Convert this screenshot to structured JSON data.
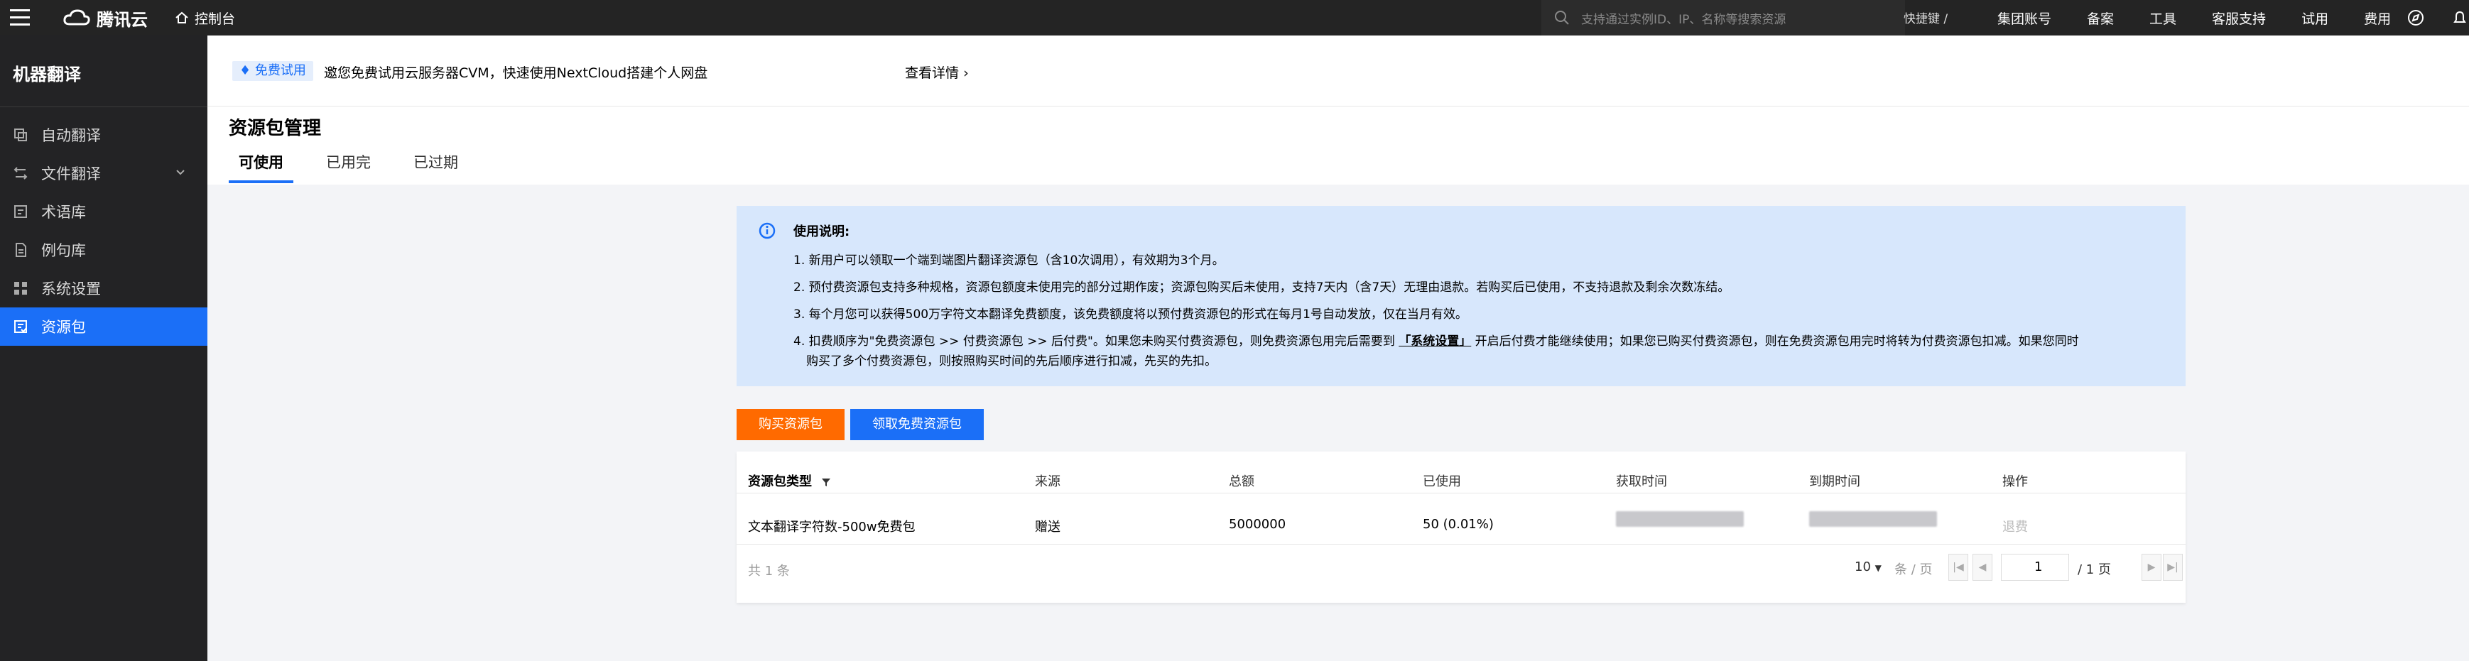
{
  "topbar": {
    "brand": "腾讯云",
    "console": "控制台",
    "search_placeholder": "支持通过实例ID、IP、名称等搜索资源",
    "shortcut": "快捷键 /",
    "links": [
      "集团账号",
      "备案",
      "工具",
      "客服支持",
      "试用",
      "费用"
    ]
  },
  "sidebar": {
    "title": "机器翻译",
    "items": [
      {
        "label": "自动翻译",
        "icon": "translate-icon"
      },
      {
        "label": "文件翻译",
        "icon": "file-icon"
      },
      {
        "label": "术语库",
        "icon": "glossary-icon"
      },
      {
        "label": "例句库",
        "icon": "sentence-icon"
      },
      {
        "label": "系统设置",
        "icon": "settings-grid-icon"
      },
      {
        "label": "资源包",
        "icon": "package-icon"
      }
    ]
  },
  "notice": {
    "badge": "免费试用",
    "text": "邀您免费试用云服务器CVM，快速使用NextCloud搭建个人网盘",
    "more": "查看详情"
  },
  "page": {
    "title": "资源包管理",
    "tabs": [
      "可使用",
      "已用完",
      "已过期"
    ]
  },
  "info": {
    "heading": "使用说明:",
    "line1": "1. 新用户可以领取一个端到端图片翻译资源包（含10次调用），有效期为3个月。",
    "line2": "2. 预付费资源包支持多种规格，资源包额度未使用完的部分过期作废；资源包购买后未使用，支持7天内（含7天）无理由退款。若购买后已使用，不支持退款及剩余次数冻结。",
    "line3": "3. 每个月您可以获得500万字符文本翻译免费额度，该免费额度将以预付费资源包的形式在每月1号自动发放，仅在当月有效。",
    "line4a": "4. 扣费顺序为\"免费资源包 >> 付费资源包 >> 后付费\"。如果您未购买付费资源包，则免费资源包用完后需要到",
    "line4link": "「系统设置」",
    "line4b": "开启后付费才能继续使用；如果您已购买付费资源包，则在免费资源包用完时将转为付费资源包扣减。如果您同时",
    "line5": "购买了多个付费资源包，则按照购买时间的先后顺序进行扣减，先买的先扣。"
  },
  "buttons": {
    "buy": "购买资源包",
    "free": "领取免费资源包"
  },
  "table": {
    "headers": [
      "资源包类型",
      "来源",
      "总额",
      "已使用",
      "获取时间",
      "到期时间",
      "操作"
    ],
    "row": {
      "type": "文本翻译字符数-500w免费包",
      "source": "赠送",
      "total": "5000000",
      "used": "50 (0.01%)",
      "action": "退费"
    },
    "footer_total": "共 1 条",
    "page_size": "10",
    "page_size_label": "条 / 页",
    "page_current": "1",
    "page_total": "/ 1 页"
  }
}
